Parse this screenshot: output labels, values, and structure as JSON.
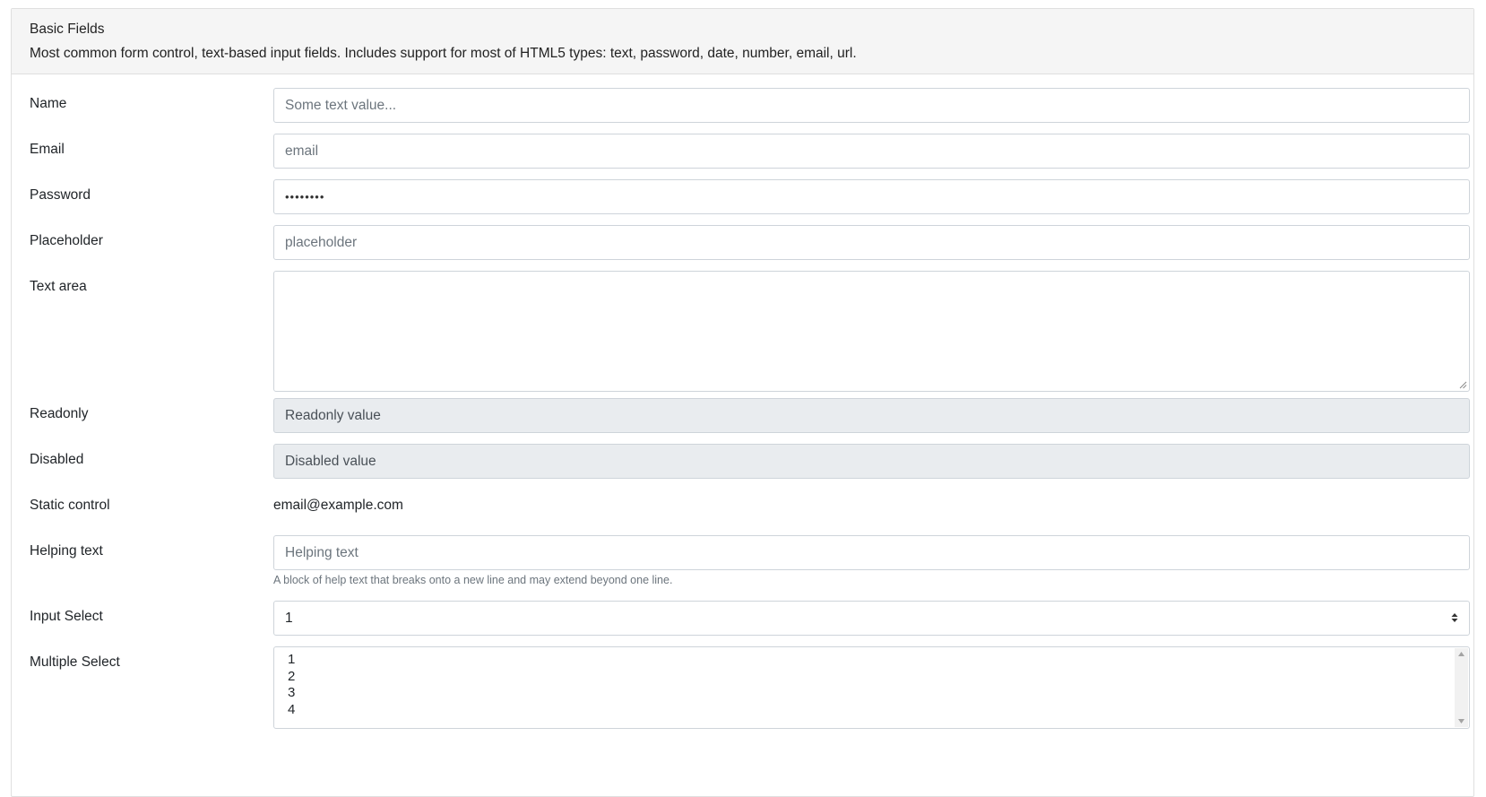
{
  "card": {
    "title": "Basic Fields",
    "description": "Most common form control, text-based input fields. Includes support for most of HTML5 types: text, password, date, number, email, url."
  },
  "fields": {
    "name": {
      "label": "Name",
      "placeholder": "Some text value..."
    },
    "email": {
      "label": "Email",
      "placeholder": "email"
    },
    "password": {
      "label": "Password",
      "value": "••••••••"
    },
    "placeholder": {
      "label": "Placeholder",
      "placeholder": "placeholder"
    },
    "textarea": {
      "label": "Text area",
      "value": ""
    },
    "readonly": {
      "label": "Readonly",
      "value": "Readonly value"
    },
    "disabled": {
      "label": "Disabled",
      "value": "Disabled value"
    },
    "static": {
      "label": "Static control",
      "value": "email@example.com"
    },
    "helping": {
      "label": "Helping text",
      "placeholder": "Helping text",
      "help": "A block of help text that breaks onto a new line and may extend beyond one line."
    },
    "select": {
      "label": "Input Select",
      "value": "1"
    },
    "multi": {
      "label": "Multiple Select",
      "options": [
        "1",
        "2",
        "3",
        "4"
      ]
    }
  },
  "colors": {
    "border": "#ced4da",
    "readonly_bg": "#e9ecef",
    "header_bg": "#f5f5f5"
  }
}
